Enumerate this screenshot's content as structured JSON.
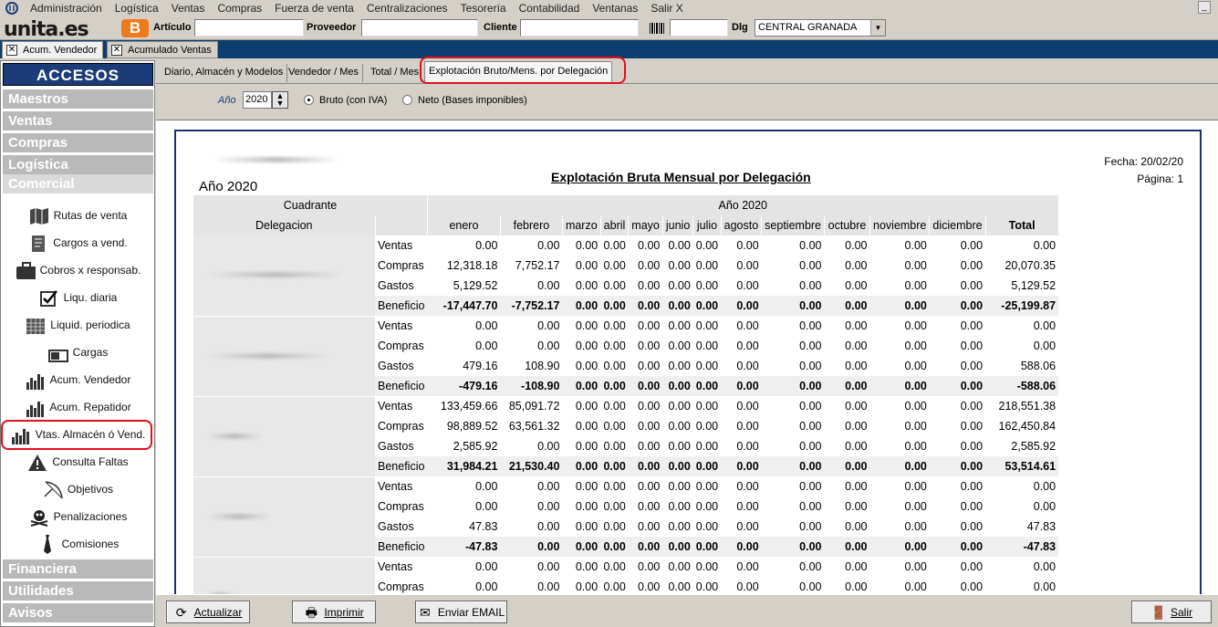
{
  "menu": {
    "items": [
      "Administración",
      "Logística",
      "Ventas",
      "Compras",
      "Fuerza de venta",
      "Centralizaciones",
      "Tesorería",
      "Contabilidad",
      "Ventanas",
      "Salir X"
    ]
  },
  "toolbar": {
    "brand": "unita.es",
    "blogger": "B",
    "articulo_label": "Artículo",
    "proveedor_label": "Proveedor",
    "cliente_label": "Cliente",
    "dlg_label": "Dlg",
    "dlg_value": "CENTRAL GRANADA"
  },
  "doc_tabs": [
    {
      "label": "Acum. Vendedor"
    },
    {
      "label": "Acumulado Ventas"
    }
  ],
  "sidebar": {
    "header": "ACCESOS",
    "sections": [
      "Maestros",
      "Ventas",
      "Compras",
      "Logística",
      "Comercial",
      "Financiera",
      "Utilidades",
      "Avisos"
    ],
    "items": [
      "Rutas de venta",
      "Cargos a vend.",
      "Cobros x responsab.",
      "Liqu. diaria",
      "Liquid. periodica",
      "Cargas",
      "Acum. Vendedor",
      "Acum. Repatidor",
      "Vtas. Almacén ó Vend.",
      "Consulta Faltas",
      "Objetivos",
      "Penalizaciones",
      "Comisiones"
    ]
  },
  "page_tabs": [
    "Diario, Almacén y Modelos",
    "Vendedor / Mes",
    "Total / Mes",
    "Explotación Bruto/Mens. por Delegación"
  ],
  "options": {
    "year_label": "Año",
    "year_value": "2020",
    "bruto_label": "Bruto (con IVA)",
    "neto_label": "Neto (Bases imponibles)"
  },
  "report": {
    "title": "Explotación Bruta Mensual por Delegación",
    "fecha": "Fecha: 20/02/20",
    "pagina": "Página: 1",
    "year_heading": "Año 2020",
    "head_cuadrante": "Cuadrante",
    "head_year": "Año 2020",
    "head_delegacion": "Delegacion",
    "months": [
      "enero",
      "febrero",
      "marzo",
      "abril",
      "mayo",
      "junio",
      "julio",
      "agosto",
      "septiembre",
      "octubre",
      "noviembre",
      "diciembre",
      "Total"
    ],
    "groups": [
      {
        "rows": [
          {
            "label": "Ventas",
            "values": [
              "0.00",
              "0.00",
              "0.00",
              "0.00",
              "0.00",
              "0.00",
              "0.00",
              "0.00",
              "0.00",
              "0.00",
              "0.00",
              "0.00",
              "0.00"
            ]
          },
          {
            "label": "Compras",
            "values": [
              "12,318.18",
              "7,752.17",
              "0.00",
              "0.00",
              "0.00",
              "0.00",
              "0.00",
              "0.00",
              "0.00",
              "0.00",
              "0.00",
              "0.00",
              "20,070.35"
            ]
          },
          {
            "label": "Gastos",
            "values": [
              "5,129.52",
              "0.00",
              "0.00",
              "0.00",
              "0.00",
              "0.00",
              "0.00",
              "0.00",
              "0.00",
              "0.00",
              "0.00",
              "0.00",
              "5,129.52"
            ]
          },
          {
            "label": "Beneficio",
            "values": [
              "-17,447.70",
              "-7,752.17",
              "0.00",
              "0.00",
              "0.00",
              "0.00",
              "0.00",
              "0.00",
              "0.00",
              "0.00",
              "0.00",
              "0.00",
              "-25,199.87"
            ]
          }
        ]
      },
      {
        "rows": [
          {
            "label": "Ventas",
            "values": [
              "0.00",
              "0.00",
              "0.00",
              "0.00",
              "0.00",
              "0.00",
              "0.00",
              "0.00",
              "0.00",
              "0.00",
              "0.00",
              "0.00",
              "0.00"
            ]
          },
          {
            "label": "Compras",
            "values": [
              "0.00",
              "0.00",
              "0.00",
              "0.00",
              "0.00",
              "0.00",
              "0.00",
              "0.00",
              "0.00",
              "0.00",
              "0.00",
              "0.00",
              "0.00"
            ]
          },
          {
            "label": "Gastos",
            "values": [
              "479.16",
              "108.90",
              "0.00",
              "0.00",
              "0.00",
              "0.00",
              "0.00",
              "0.00",
              "0.00",
              "0.00",
              "0.00",
              "0.00",
              "588.06"
            ]
          },
          {
            "label": "Beneficio",
            "values": [
              "-479.16",
              "-108.90",
              "0.00",
              "0.00",
              "0.00",
              "0.00",
              "0.00",
              "0.00",
              "0.00",
              "0.00",
              "0.00",
              "0.00",
              "-588.06"
            ]
          }
        ]
      },
      {
        "rows": [
          {
            "label": "Ventas",
            "values": [
              "133,459.66",
              "85,091.72",
              "0.00",
              "0.00",
              "0.00",
              "0.00",
              "0.00",
              "0.00",
              "0.00",
              "0.00",
              "0.00",
              "0.00",
              "218,551.38"
            ]
          },
          {
            "label": "Compras",
            "values": [
              "98,889.52",
              "63,561.32",
              "0.00",
              "0.00",
              "0.00",
              "0.00",
              "0.00",
              "0.00",
              "0.00",
              "0.00",
              "0.00",
              "0.00",
              "162,450.84"
            ]
          },
          {
            "label": "Gastos",
            "values": [
              "2,585.92",
              "0.00",
              "0.00",
              "0.00",
              "0.00",
              "0.00",
              "0.00",
              "0.00",
              "0.00",
              "0.00",
              "0.00",
              "0.00",
              "2,585.92"
            ]
          },
          {
            "label": "Beneficio",
            "values": [
              "31,984.21",
              "21,530.40",
              "0.00",
              "0.00",
              "0.00",
              "0.00",
              "0.00",
              "0.00",
              "0.00",
              "0.00",
              "0.00",
              "0.00",
              "53,514.61"
            ]
          }
        ]
      },
      {
        "rows": [
          {
            "label": "Ventas",
            "values": [
              "0.00",
              "0.00",
              "0.00",
              "0.00",
              "0.00",
              "0.00",
              "0.00",
              "0.00",
              "0.00",
              "0.00",
              "0.00",
              "0.00",
              "0.00"
            ]
          },
          {
            "label": "Compras",
            "values": [
              "0.00",
              "0.00",
              "0.00",
              "0.00",
              "0.00",
              "0.00",
              "0.00",
              "0.00",
              "0.00",
              "0.00",
              "0.00",
              "0.00",
              "0.00"
            ]
          },
          {
            "label": "Gastos",
            "values": [
              "47.83",
              "0.00",
              "0.00",
              "0.00",
              "0.00",
              "0.00",
              "0.00",
              "0.00",
              "0.00",
              "0.00",
              "0.00",
              "0.00",
              "47.83"
            ]
          },
          {
            "label": "Beneficio",
            "values": [
              "-47.83",
              "0.00",
              "0.00",
              "0.00",
              "0.00",
              "0.00",
              "0.00",
              "0.00",
              "0.00",
              "0.00",
              "0.00",
              "0.00",
              "-47.83"
            ]
          }
        ]
      },
      {
        "rows": [
          {
            "label": "Ventas",
            "values": [
              "0.00",
              "0.00",
              "0.00",
              "0.00",
              "0.00",
              "0.00",
              "0.00",
              "0.00",
              "0.00",
              "0.00",
              "0.00",
              "0.00",
              "0.00"
            ]
          },
          {
            "label": "Compras",
            "values": [
              "0.00",
              "0.00",
              "0.00",
              "0.00",
              "0.00",
              "0.00",
              "0.00",
              "0.00",
              "0.00",
              "0.00",
              "0.00",
              "0.00",
              "0.00"
            ]
          }
        ]
      }
    ]
  },
  "buttons": {
    "actualizar": "Actualizar",
    "imprimir": "Imprimir",
    "email": "Enviar EMAIL",
    "salir": "Salir"
  },
  "colors": {
    "accent_navy": "#1c3c78",
    "highlight_red": "#e0101c",
    "tabbar": "#0b3d6e",
    "blogger_orange": "#f07a1a"
  }
}
